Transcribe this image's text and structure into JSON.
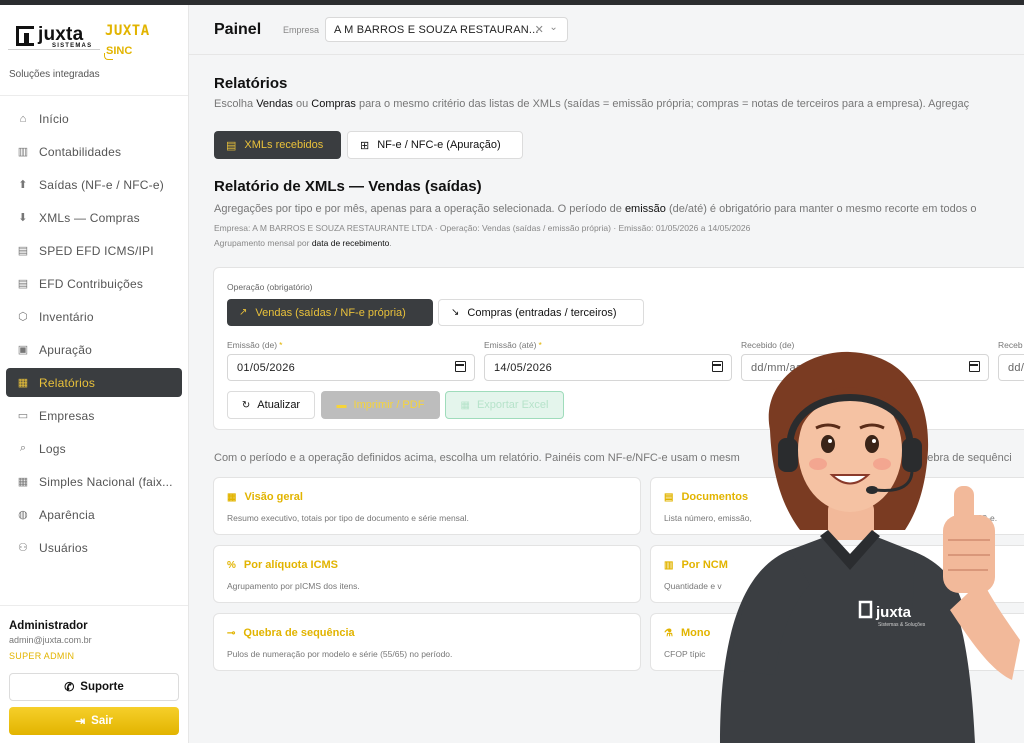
{
  "sidebar": {
    "logo_text": "juxta",
    "logo_sub": "SISTEMAS",
    "sinc_brand": "JUXTA",
    "sinc_label": "SINC",
    "tagline": "Soluções integradas",
    "items": [
      {
        "label": "Início",
        "icon": "home-icon"
      },
      {
        "label": "Contabilidades",
        "icon": "building-icon"
      },
      {
        "label": "Saídas (NF-e / NFC-e)",
        "icon": "arrow-up-icon"
      },
      {
        "label": "XMLs — Compras",
        "icon": "arrow-down-icon"
      },
      {
        "label": "SPED EFD ICMS/IPI",
        "icon": "file-icon"
      },
      {
        "label": "EFD Contribuições",
        "icon": "file-icon"
      },
      {
        "label": "Inventário",
        "icon": "box-icon"
      },
      {
        "label": "Apuração",
        "icon": "clipboard-icon"
      },
      {
        "label": "Relatórios",
        "icon": "chart-icon",
        "active": true
      },
      {
        "label": "Empresas",
        "icon": "briefcase-icon"
      },
      {
        "label": "Logs",
        "icon": "search-file-icon"
      },
      {
        "label": "Simples Nacional (faix...",
        "icon": "calculator-icon"
      },
      {
        "label": "Aparência",
        "icon": "palette-icon"
      },
      {
        "label": "Usuários",
        "icon": "users-icon"
      }
    ],
    "user": {
      "name": "Administrador",
      "email": "admin@juxta.com.br",
      "role": "SUPER ADMIN"
    },
    "support_label": "Suporte",
    "logout_label": "Sair"
  },
  "header": {
    "title": "Painel",
    "company_label": "Empresa",
    "company_value": "A M BARROS E SOUZA RESTAURAN...",
    "clear_icon": "close-icon",
    "chevron_icon": "chevron-down-icon"
  },
  "main": {
    "title": "Relatórios",
    "desc_pre": "Escolha ",
    "desc_vendas": "Vendas",
    "desc_mid": " ou ",
    "desc_compras": "Compras",
    "desc_post": " para o mesmo critério das listas de XMLs (saídas = emissão própria; compras = notas de terceiros para a empresa). Agregaç",
    "tabs": [
      {
        "label": "XMLs recebidos",
        "icon": "document-icon",
        "active": true
      },
      {
        "label": "NF-e / NFC-e (Apuração)",
        "icon": "grid-icon",
        "active": false
      }
    ],
    "report_title": "Relatório de XMLs — Vendas (saídas)",
    "report_desc_pre": "Agregações por tipo e por mês, apenas para a operação selecionada. O período de ",
    "report_desc_bold": "emissão",
    "report_desc_post": " (de/até) é obrigatório para manter o mesmo recorte em todos o",
    "report_meta": "Empresa: A M BARROS E SOUZA RESTAURANTE LTDA · Operação: Vendas (saídas / emissão própria) · Emissão: 01/05/2026 a 14/05/2026",
    "report_group_pre": "Agrupamento mensal por ",
    "report_group_bold": "data de recebimento",
    "report_group_post": ".",
    "filters": {
      "op_label": "Operação (obrigatório)",
      "op_vendas": "Vendas (saídas / NF-e própria)",
      "op_compras": "Compras (entradas / terceiros)",
      "emissao_de_label": "Emissão (de)",
      "emissao_de_value": "01/05/2026",
      "emissao_ate_label": "Emissão (até)",
      "emissao_ate_value": "14/05/2026",
      "recebido_de_label": "Recebido (de)",
      "recebido_de_value": "dd/mm/aaaa",
      "recebido_ate_label": "Receb",
      "recebido_ate_value": "dd/",
      "required_mark": "*",
      "refresh_label": "Atualizar",
      "print_label": "Imprimir / PDF",
      "export_label": "Exportar Excel"
    },
    "pick_desc": "Com o período e a operação definidos acima, escolha um relatório. Painéis com NF-e/NFC-e usam o mesm",
    "pick_desc_right": "quebra de sequênci",
    "reports": [
      {
        "title": "Visão geral",
        "desc": "Resumo executivo, totais por tipo de documento e série mensal.",
        "icon": "dashboard-icon"
      },
      {
        "title": "Documentos",
        "desc": "Lista número, emissão,",
        "desc_right": "/ NFC-e.",
        "icon": "document-icon"
      },
      {
        "title": "Por alíquota ICMS",
        "desc": "Agrupamento por pICMS dos itens.",
        "icon": "percent-icon"
      },
      {
        "title": "Por NCM",
        "desc": "Quantidade e v",
        "icon": "barcode-icon"
      },
      {
        "title": "Quebra de sequência",
        "desc": "Pulos de numeração por modelo e série (55/65) no período.",
        "icon": "sequence-icon"
      },
      {
        "title": "Mono",
        "desc": "CFOP típic",
        "icon": "flask-icon"
      }
    ]
  },
  "mascot": {
    "shirt_brand": "juxta",
    "shirt_sub": "Sistemas & Soluções"
  },
  "colors": {
    "accent": "#e2b400",
    "dark": "#3a3d40",
    "active_text": "#e9c13a"
  }
}
